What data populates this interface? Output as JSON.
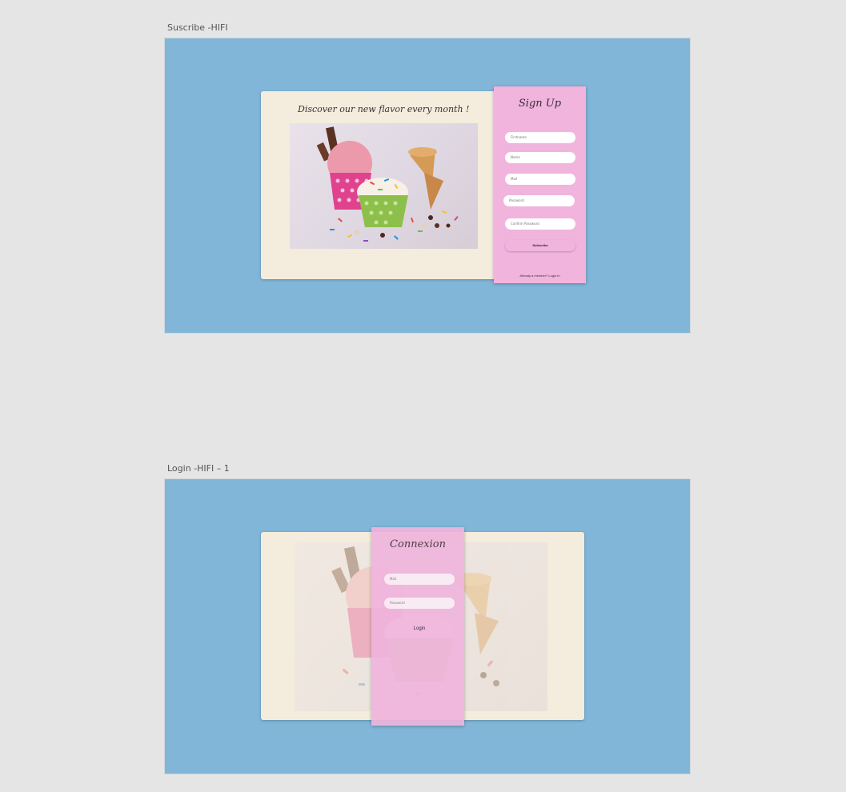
{
  "artboards": {
    "signup": {
      "label": "Suscribe -HIFI",
      "card_heading": "Discover our new flavor every month !",
      "panel_title": "Sign Up",
      "fields": [
        {
          "placeholder": "Firstname"
        },
        {
          "placeholder": "Name"
        },
        {
          "placeholder": "Mail"
        },
        {
          "placeholder": "Password"
        },
        {
          "placeholder": "Confirm Password"
        }
      ],
      "submit_label": "Subscribe",
      "footer_text": "Already a member? Login In"
    },
    "login": {
      "label": "Login -HIFI – 1",
      "panel_title": "Connexion",
      "fields": [
        {
          "placeholder": "Mail"
        },
        {
          "placeholder": "Password"
        }
      ],
      "submit_label": "Login"
    }
  },
  "colors": {
    "canvas": "#e5e5e5",
    "artboard_bg": "#81b6d9",
    "card_bg": "#f4ecdc",
    "panel_pink": "#f0b4dd"
  },
  "images": {
    "hero": "ice-cream-cups-with-sprinkles-and-cones"
  }
}
